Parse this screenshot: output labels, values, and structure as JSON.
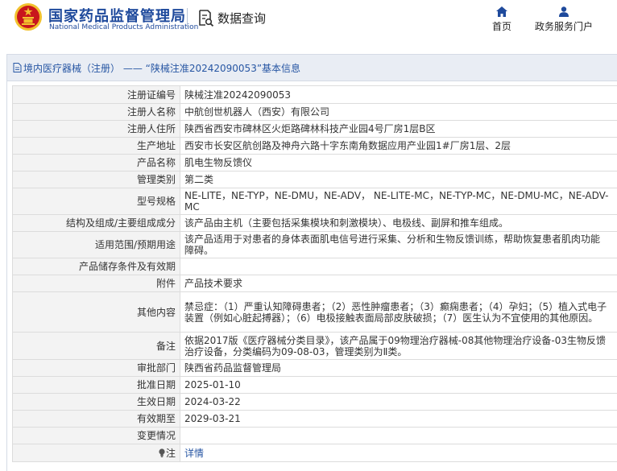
{
  "header": {
    "logo_cn": "国家药品监督管理局",
    "logo_en": "National Medical Products Administration",
    "query_label": "数据查询",
    "nav_home": "首页",
    "nav_user": "政务服务门户"
  },
  "breadcrumb": {
    "title": "境内医疗器械（注册） —— “陕械注准20242090053”基本信息"
  },
  "colors": {
    "brand_blue": "#1f4a9c",
    "link_blue": "#2756a3",
    "label_bg": "#f3f3f3",
    "title_bg": "#e9edf4",
    "emblem_red": "#c8161d",
    "emblem_gold": "#f2c12e"
  },
  "icons": {
    "emblem": "national-emblem-icon",
    "query": "document-search-icon",
    "home": "home-icon",
    "user": "user-icon",
    "doc": "document-icon",
    "note": "lightbulb-icon"
  },
  "rows": [
    {
      "label": "注册证编号",
      "value": "陕械注准20242090053"
    },
    {
      "label": "注册人名称",
      "value": "中航创世机器人（西安）有限公司"
    },
    {
      "label": "注册人住所",
      "value": "陕西省西安市碑林区火炬路碑林科技产业园4号厂房1层B区"
    },
    {
      "label": "生产地址",
      "value": "西安市长安区航创路及神舟六路十字东南角数据应用产业园1#厂房1层、2层"
    },
    {
      "label": "产品名称",
      "value": "肌电生物反馈仪"
    },
    {
      "label": "管理类别",
      "value": "第二类"
    },
    {
      "label": "型号规格",
      "value": "NE-LITE，NE-TYP，NE-DMU，NE-ADV， NE-LITE-MC，NE-TYP-MC，NE-DMU-MC，NE-ADV-MC"
    },
    {
      "label": "结构及组成/主要组成成分",
      "value": "该产品由主机（主要包括采集模块和刺激模块）、电极线、副屏和推车组成。"
    },
    {
      "label": "适用范围/预期用途",
      "value": "该产品适用于对患者的身体表面肌电信号进行采集、分析和生物反馈训练，帮助恢复患者肌肉功能障碍。"
    },
    {
      "label": "产品储存条件及有效期",
      "value": ""
    },
    {
      "label": "附件",
      "value": "产品技术要求"
    },
    {
      "label": "其他内容",
      "value": "禁忌症：（1）严重认知障碍患者；（2）恶性肿瘤患者；（3）癫痫患者；（4）孕妇；（5）植入式电子装置（例如心脏起搏器）；（6）电极接触表面局部皮肤破损；（7）医生认为不宜使用的其他原因。"
    },
    {
      "label": "备注",
      "value": "依据2017版《医疗器械分类目录》，该产品属于09物理治疗器械-08其他物理治疗设备-03生物反馈治疗设备，分类编码为09-08-03，管理类别为Ⅱ类。"
    },
    {
      "label": "审批部门",
      "value": "陕西省药品监督管理局"
    },
    {
      "label": "批准日期",
      "value": "2025-01-10"
    },
    {
      "label": "生效日期",
      "value": "2024-03-22"
    },
    {
      "label": "有效期至",
      "value": "2029-03-21"
    },
    {
      "label": "变更情况",
      "value": ""
    }
  ],
  "note": {
    "label": "注",
    "value": "详情"
  }
}
